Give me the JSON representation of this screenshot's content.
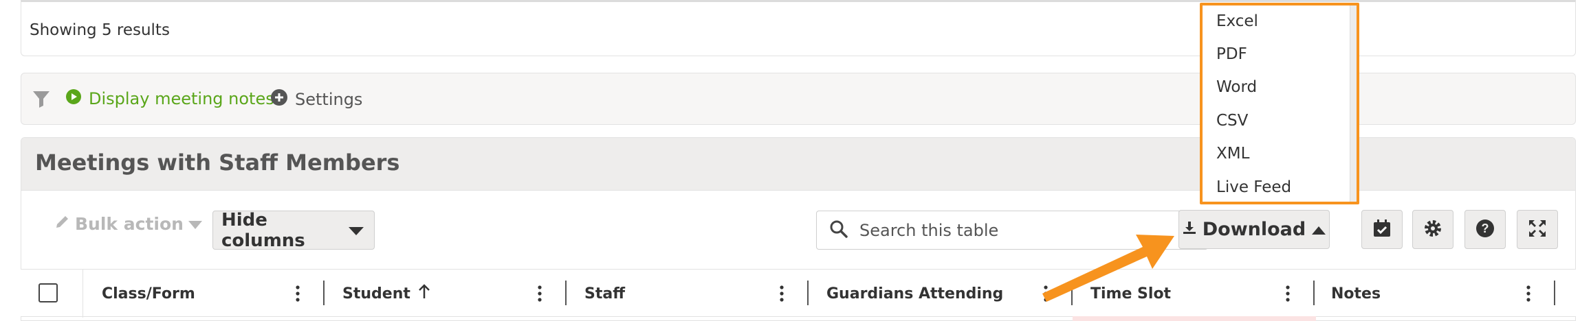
{
  "results": {
    "text": "Showing 5 results"
  },
  "filter_bar": {
    "display_notes_label": "Display meeting notes",
    "settings_label": "Settings"
  },
  "section": {
    "title": "Meetings with Staff Members"
  },
  "toolbar": {
    "bulk_action_label": "Bulk action",
    "hide_columns_label": "Hide columns",
    "search_placeholder": "Search this table",
    "download_label": "Download"
  },
  "columns": [
    {
      "label": "Class/Form"
    },
    {
      "label": "Student"
    },
    {
      "label": "Staff"
    },
    {
      "label": "Guardians Attending"
    },
    {
      "label": "Time Slot"
    },
    {
      "label": "Notes"
    }
  ],
  "download_menu": {
    "items": [
      "Excel",
      "PDF",
      "Word",
      "CSV",
      "XML",
      "Live Feed"
    ]
  },
  "colors": {
    "accent_green": "#5aa61a",
    "highlight_orange": "#f7931e"
  }
}
